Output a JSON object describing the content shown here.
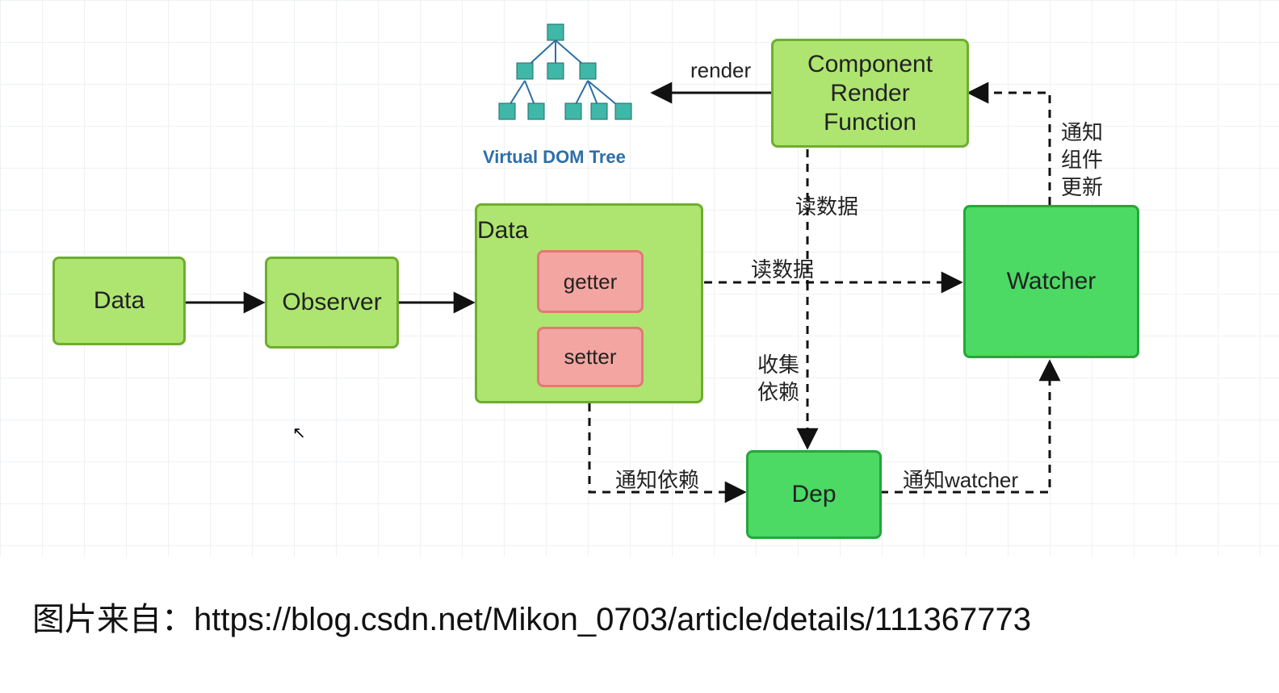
{
  "nodes": {
    "data_left": "Data",
    "observer": "Observer",
    "data_center": "Data",
    "getter": "getter",
    "setter": "setter",
    "component_line1": "Component",
    "component_line2": "Render",
    "component_line3": "Function",
    "watcher": "Watcher",
    "dep": "Dep"
  },
  "edges": {
    "render": "render",
    "read_data_top": "读数据",
    "read_data_mid": "读数据",
    "collect_dep": "收集\n依赖",
    "notify_dep": "通知依赖",
    "notify_watcher": "通知watcher",
    "notify_component": "通知\n组件\n更新"
  },
  "vdom_caption": "Virtual DOM Tree",
  "attribution_prefix": "图片来自：",
  "attribution_url": "https://blog.csdn.net/Mikon_0703/article/details/111367773"
}
